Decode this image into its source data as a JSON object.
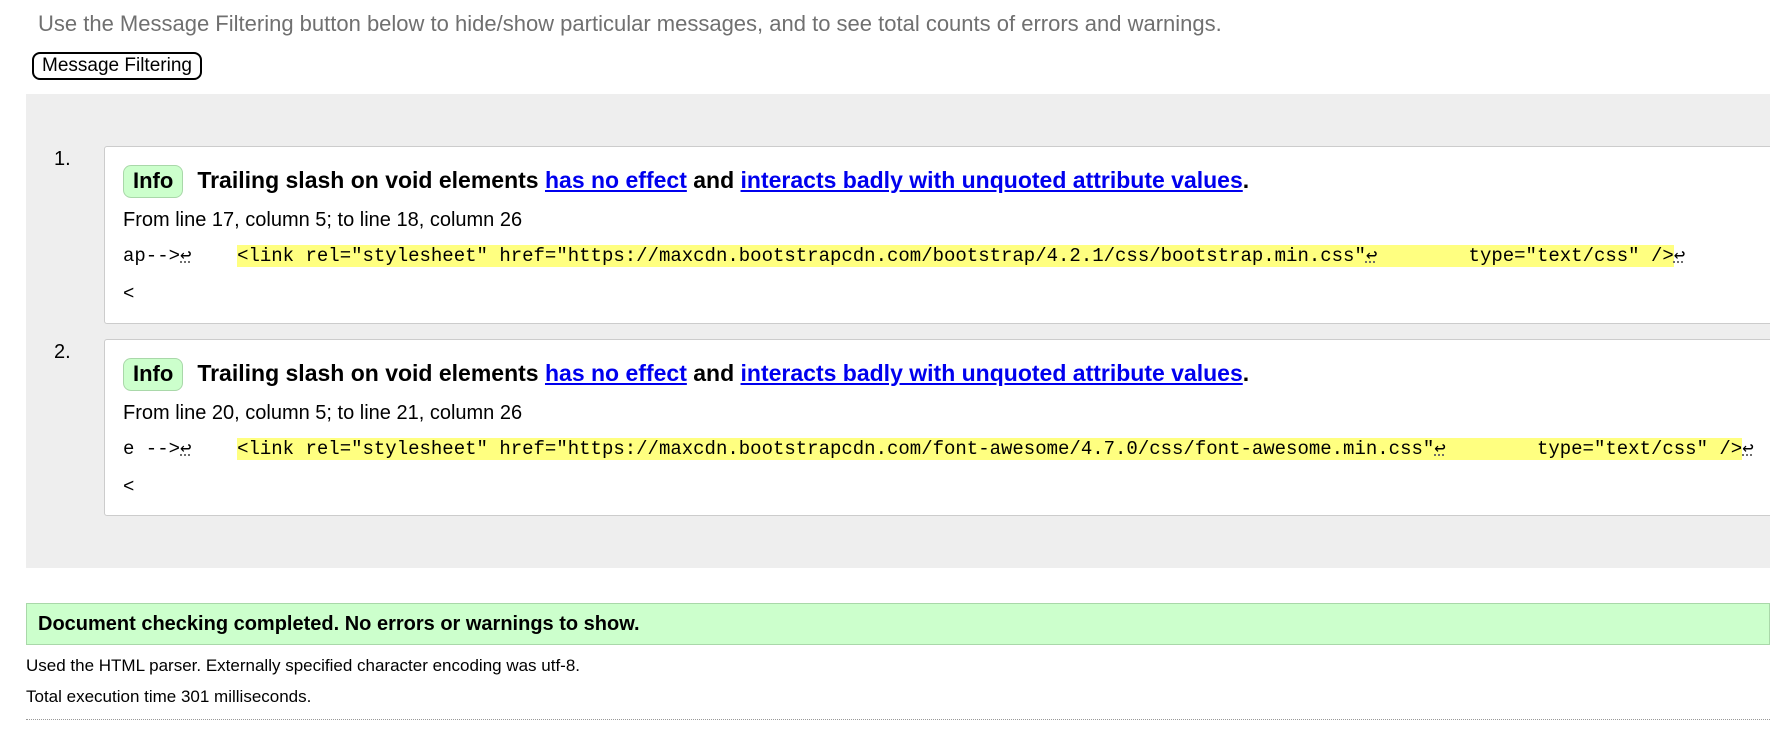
{
  "intro": "Use the Message Filtering button below to hide/show particular messages, and to see total counts of errors and warnings.",
  "filter_button": "Message Filtering",
  "messages": [
    {
      "num": "1.",
      "type": "Info",
      "text_before": "Trailing slash on void elements",
      "link1": "has no effect",
      "conj": "and",
      "link2": "interacts badly with unquoted attribute values",
      "end": ".",
      "location": "From line 17, column 5; to line 18, column 26",
      "extract_pre": "ap-->",
      "lf": "↩",
      "extract_gap": "    ",
      "highlight_part1": "<link rel=\"stylesheet\" href=\"https://maxcdn.bootstrapcdn.com/bootstrap/4.2.1/css/bootstrap.min.css\"",
      "highlight_gap": "        ",
      "highlight_part2": "type=\"text/css\" />",
      "extract_post": "<"
    },
    {
      "num": "2.",
      "type": "Info",
      "text_before": "Trailing slash on void elements",
      "link1": "has no effect",
      "conj": "and",
      "link2": "interacts badly with unquoted attribute values",
      "end": ".",
      "location": "From line 20, column 5; to line 21, column 26",
      "extract_pre": "e -->",
      "lf": "↩",
      "extract_gap": "    ",
      "highlight_part1": "<link rel=\"stylesheet\" href=\"https://maxcdn.bootstrapcdn.com/font-awesome/4.7.0/css/font-awesome.min.css\"",
      "highlight_gap": "        ",
      "highlight_part2": "type=\"text/css\" />",
      "extract_post": "<"
    }
  ],
  "summary": "Document checking completed. No errors or warnings to show.",
  "details": [
    "Used the HTML parser. Externally specified character encoding was utf-8.",
    "Total execution time 301 milliseconds."
  ],
  "colors": {
    "info_badge": "#ccffcc",
    "highlight": "#ffff80",
    "link": "#0000ee",
    "panel": "#eeeeee"
  }
}
